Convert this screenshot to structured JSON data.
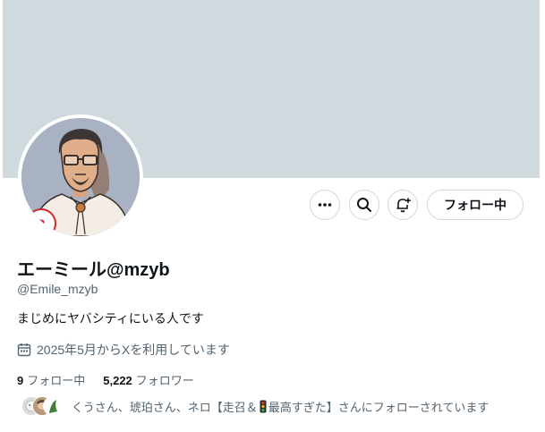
{
  "profile": {
    "display_name": "エーミール@mzyb",
    "handle": "@Emile_mzyb",
    "bio": "まじめにヤバシティにいる人です",
    "joined": "2025年5月からXを利用しています"
  },
  "stats": {
    "following_count": "9",
    "following_label": "フォロー中",
    "followers_count": "5,222",
    "followers_label": "フォロワー"
  },
  "actions": {
    "follow_label": "フォロー中"
  },
  "followed_by": {
    "text_before": "くうさん、琥珀さん、ネロ【走召＆",
    "text_after": "最高すぎた】さんにフォローされています"
  },
  "colors": {
    "banner": "#cfd9de",
    "secondary_text": "#536471",
    "primary_text": "#0f1419",
    "border": "#cfd9de"
  },
  "icons": [
    "more-icon",
    "search-icon",
    "notification-add-icon",
    "calendar-icon",
    "traffic-light-icon"
  ]
}
